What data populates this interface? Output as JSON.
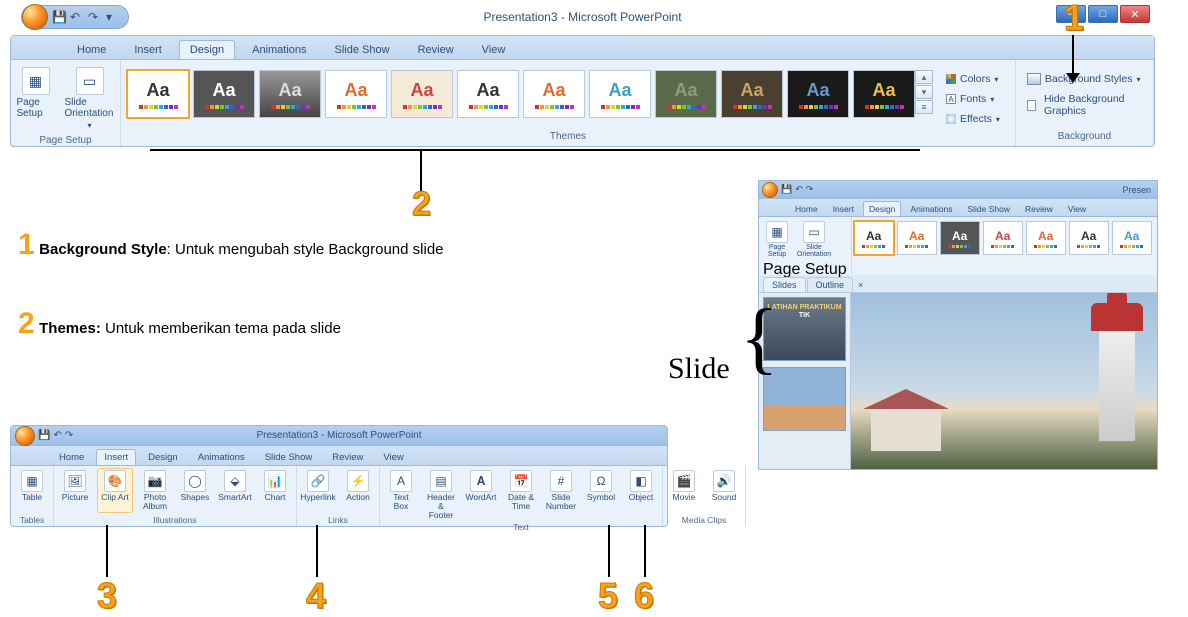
{
  "callouts": {
    "n1": "1",
    "n2": "2",
    "n3": "3",
    "n4": "4",
    "n5": "5",
    "n6": "6"
  },
  "notes": {
    "line1_num": "1",
    "line1_bold": "Background Style",
    "line1_rest": ": Untuk mengubah style Background slide",
    "line2_num": "2",
    "line2_bold": "Themes:",
    "line2_rest": " Untuk memberikan tema pada slide",
    "slide_label": "Slide"
  },
  "main": {
    "title": "Presentation3 - Microsoft PowerPoint",
    "tabs": [
      "Home",
      "Insert",
      "Design",
      "Animations",
      "Slide Show",
      "Review",
      "View"
    ],
    "active_tab": "Design",
    "page_setup": {
      "page_setup": "Page Setup",
      "orientation": "Slide Orientation ▾",
      "group": "Page Setup"
    },
    "themes_group": "Themes",
    "theme_aa": "Aa",
    "theme_palettes": [
      [
        "#c0504d",
        "#9bbb59",
        "#4f81bd",
        "#8064a2",
        "#f79646",
        "#4bacc6",
        "#1f497d",
        "#808080"
      ],
      [
        "#555555",
        "#9bbb59",
        "#c0504d",
        "#4f81bd",
        "#f79646",
        "#4bacc6",
        "#1f497d",
        "#333333"
      ],
      [
        "#666666",
        "#b0763d",
        "#6c8e3b",
        "#3f6faa",
        "#9a5b9c",
        "#d98c34",
        "#3c9aad",
        "#222222"
      ],
      [
        "#d98c34",
        "#c0504d",
        "#9bbb59",
        "#4f81bd",
        "#8064a2",
        "#f79646",
        "#4bacc6",
        "#1f497d"
      ],
      [
        "#c0504d",
        "#d98c34",
        "#9bbb59",
        "#4f81bd",
        "#8064a2",
        "#f79646",
        "#4bacc6",
        "#1f497d"
      ],
      [
        "#ffffff",
        "#bfbfbf",
        "#808080",
        "#595959",
        "#404040",
        "#262626",
        "#0d0d0d",
        "#000000"
      ],
      [
        "#c00000",
        "#ed7d31",
        "#ffc000",
        "#70ad47",
        "#5b9bd5",
        "#4472c4",
        "#7030a0",
        "#000000"
      ],
      [
        "#2e75b6",
        "#5b9bd5",
        "#9cc3e6",
        "#bdd7ee",
        "#deebf7",
        "#f2f2f2",
        "#ffffff",
        "#000000"
      ],
      [
        "#548235",
        "#70ad47",
        "#a9d08e",
        "#c6e0b4",
        "#e2efda",
        "#f2f2f2",
        "#ffffff",
        "#000000"
      ],
      [
        "#7f6000",
        "#bf8f00",
        "#ffd966",
        "#fff2cc",
        "#ffffff",
        "#f2f2f2",
        "#000000",
        "#806000"
      ],
      [
        "#3c6a9c",
        "#5b9bd5",
        "#9cc3e6",
        "#bdd7ee",
        "#deebf7",
        "#f2f2f2",
        "#000000",
        "#1f4e79"
      ],
      [
        "#000000",
        "#3b3838",
        "#757171",
        "#afabab",
        "#d0cece",
        "#e7e6e6",
        "#ffffff",
        "#c00000"
      ]
    ],
    "theme_bg": [
      "#ffffff",
      "#f2f2f2",
      "#595959",
      "#ffffff",
      "#fef5e7",
      "#ffffff",
      "#ffffff",
      "#2e75b6",
      "#548235",
      "#7f6000",
      "#3c6a9c",
      "#000000"
    ],
    "theme_fg": [
      "#333333",
      "#333333",
      "#ffffff",
      "#d98c34",
      "#c0504d",
      "#333333",
      "#c00000",
      "#ffffff",
      "#ffffff",
      "#ffd966",
      "#9cc3e6",
      "#ffd966"
    ],
    "colors_btn": "Colors ▾",
    "fonts_btn": "Fonts ▾",
    "effects_btn": "Effects ▾",
    "bg_styles": "Background Styles ▾",
    "hide_bg": "Hide Background Graphics",
    "bg_group": "Background"
  },
  "mini": {
    "title": "Present",
    "tabs": [
      "Home",
      "Insert",
      "Design",
      "Animations",
      "Slide Show",
      "Review",
      "View"
    ],
    "active_tab": "Design",
    "page_setup": "Page Setup",
    "orientation": "Slide Orientation ▾",
    "group": "Page Setup",
    "slides_tab": "Slides",
    "outline_tab": "Outline",
    "close": "x",
    "slide1_caption": "LATIHAN PRAKTIKUM"
  },
  "insert": {
    "title": "Presentation3 - Microsoft PowerPoint",
    "tabs": [
      "Home",
      "Insert",
      "Design",
      "Animations",
      "Slide Show",
      "Review",
      "View"
    ],
    "active_tab": "Insert",
    "btns": {
      "table": "Table",
      "picture": "Picture",
      "clipart": "Clip Art",
      "photoalbum": "Photo Album ▾",
      "shapes": "Shapes",
      "smartart": "SmartArt",
      "chart": "Chart",
      "hyperlink": "Hyperlink",
      "action": "Action",
      "textbox": "Text Box",
      "headerfooter": "Header & Footer",
      "wordart": "WordArt",
      "datetime": "Date & Time",
      "slidenumber": "Slide Number",
      "symbol": "Symbol",
      "object": "Object",
      "movie": "Movie",
      "sound": "Sound"
    },
    "groups": {
      "tables": "Tables",
      "illustrations": "Illustrations",
      "links": "Links",
      "text": "Text",
      "media": "Media Clips"
    }
  }
}
